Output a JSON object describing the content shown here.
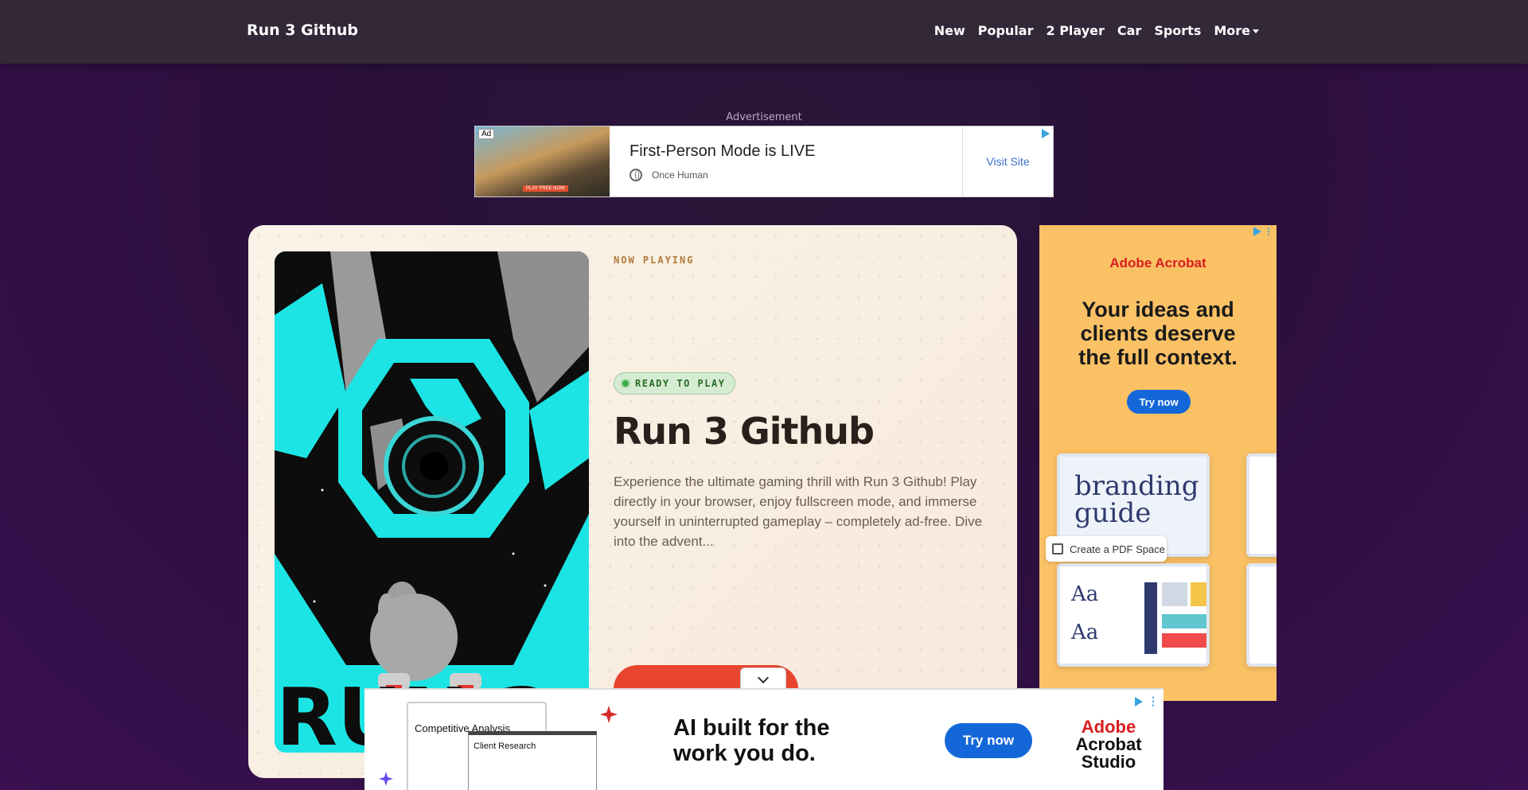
{
  "navbar": {
    "brand": "Run 3 Github",
    "links": [
      "New",
      "Popular",
      "2 Player",
      "Car",
      "Sports"
    ],
    "more_label": "More"
  },
  "top_ad": {
    "label": "Advertisement",
    "ad_tag": "Ad",
    "image_button": "PLAY FREE NOW",
    "headline": "First-Person Mode is LIVE",
    "source": "Once Human",
    "cta": "Visit Site"
  },
  "game": {
    "now_playing": "NOW PLAYING",
    "status": "READY TO PLAY",
    "title": "Run 3 Github",
    "description": "Experience the ultimate gaming thrill with Run 3 Github! Play directly in your browser, enjoy fullscreen mode, and immerse yourself in uninterrupted gameplay – completely ad-free. Dive into the advent...",
    "cover_text": "RUN 3",
    "accent_color": "#e8452e"
  },
  "side_ad": {
    "brand": "Adobe Acrobat",
    "headline_lines": [
      "Your ideas and",
      "clients deserve",
      "the full context."
    ],
    "cta": "Try now",
    "mock_title_lines": [
      "branding",
      "guide"
    ],
    "chip": "Create a PDF Space",
    "aa1": "Aa",
    "aa2": "Aa",
    "bg_color": "#fbc165"
  },
  "bottom_ad": {
    "paper1_title": "Competitive Analysis",
    "paper2_title": "Client Research",
    "headline_lines": [
      "AI built for the",
      "work you do."
    ],
    "cta": "Try now",
    "brand_lines": [
      "Adobe",
      "Acrobat",
      "Studio"
    ]
  }
}
